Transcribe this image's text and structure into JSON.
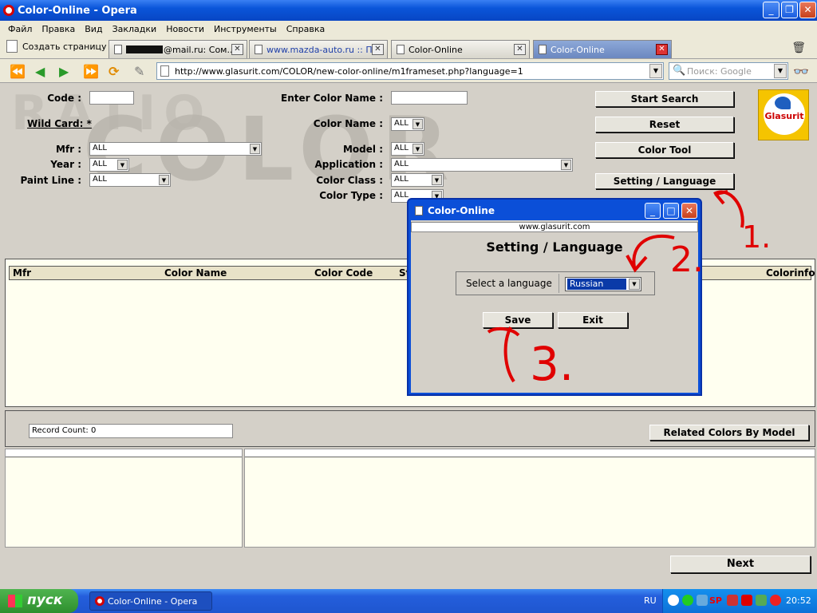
{
  "window": {
    "title": "Color-Online - Opera"
  },
  "menu": [
    "Файл",
    "Правка",
    "Вид",
    "Закладки",
    "Новости",
    "Инструменты",
    "Справка"
  ],
  "new_tab_label": "Создать страницу",
  "tabs": [
    {
      "label": "@mail.ru: Сом..."
    },
    {
      "label": "www.mazda-auto.ru :: П..."
    },
    {
      "label": "Color-Online"
    },
    {
      "label": "Color-Online"
    }
  ],
  "address": {
    "url": "http://www.glasurit.com/COLOR/new-color-online/m1frameset.php?language=1",
    "search_placeholder": "Поиск: Google"
  },
  "form": {
    "code_label": "Code :",
    "wildcard_label": "Wild Card: *",
    "mfr_label": "Mfr :",
    "mfr_value": "ALL",
    "year_label": "Year :",
    "year_value": "ALL",
    "paintline_label": "Paint Line :",
    "paintline_value": "ALL",
    "enter_color_name_label": "Enter Color Name :",
    "color_name_label": "Color Name :",
    "color_name_value": "ALL",
    "model_label": "Model :",
    "model_value": "ALL",
    "application_label": "Application :",
    "application_value": "ALL",
    "color_class_label": "Color Class :",
    "color_class_value": "ALL",
    "color_type_label": "Color Type :",
    "color_type_value": "ALL",
    "start_search": "Start Search",
    "reset": "Reset",
    "color_tool": "Color Tool",
    "setting_language": "Setting / Language",
    "logo_text": "Glasurit"
  },
  "watermark": {
    "big": "COLOR",
    "small": "RATIO"
  },
  "results": {
    "headers": [
      "Mfr",
      "Color Name",
      "Color Code",
      "St",
      "Colorinfo"
    ]
  },
  "record_count": "Record Count: 0",
  "related_colors": "Related Colors By Model",
  "next": "Next",
  "dialog": {
    "title": "Color-Online",
    "url": "www.glasurit.com",
    "heading": "Setting / Language",
    "select_label": "Select a language",
    "selected_language": "Russian",
    "save": "Save",
    "exit": "Exit"
  },
  "annotations": {
    "one": "1.",
    "two": "2.",
    "three": "3."
  },
  "taskbar": {
    "start": "пуск",
    "task": "Color-Online - Opera",
    "lang": "RU",
    "clock": "20:52",
    "tray_text": "SP"
  }
}
